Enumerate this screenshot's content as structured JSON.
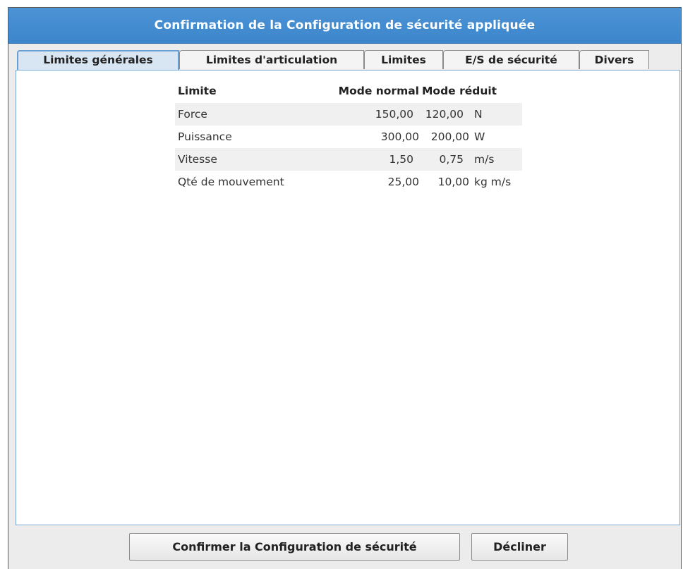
{
  "dialog": {
    "title": "Confirmation de la Configuration de sécurité appliquée"
  },
  "tabs": [
    {
      "label": "Limites générales",
      "active": true
    },
    {
      "label": "Limites d'articulation",
      "active": false
    },
    {
      "label": "Limites",
      "active": false
    },
    {
      "label": "E/S de sécurité",
      "active": false
    },
    {
      "label": "Divers",
      "active": false
    }
  ],
  "table": {
    "headers": {
      "limit": "Limite",
      "normal": "Mode normal",
      "reduced": "Mode réduit"
    },
    "rows": [
      {
        "name": "Force",
        "normal": "150,00",
        "reduced": "120,00",
        "unit": "N"
      },
      {
        "name": "Puissance",
        "normal": "300,00",
        "reduced": "200,00",
        "unit": "W"
      },
      {
        "name": "Vitesse",
        "normal": "1,50",
        "reduced": "0,75",
        "unit": "m/s"
      },
      {
        "name": "Qté de mouvement",
        "normal": "25,00",
        "reduced": "10,00",
        "unit": "kg m/s"
      }
    ]
  },
  "buttons": {
    "confirm": "Confirmer la Configuration de sécurité",
    "decline": "Décliner"
  },
  "colors": {
    "title_bar": "#3d86cc",
    "active_tab": "#d8e6f4"
  }
}
